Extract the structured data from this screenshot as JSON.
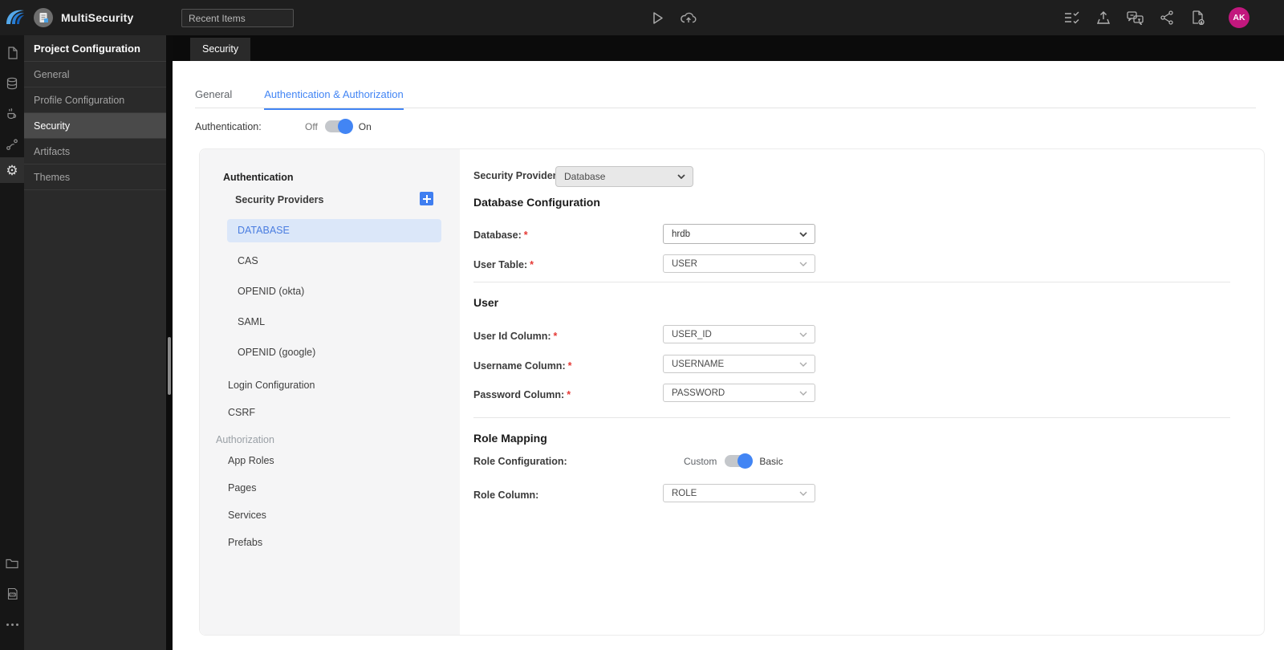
{
  "topbar": {
    "project_name": "MultiSecurity",
    "recent_items_placeholder": "Recent Items",
    "avatar_initials": "AK"
  },
  "nav": {
    "title": "Project Configuration",
    "items": [
      {
        "label": "General",
        "active": false
      },
      {
        "label": "Profile Configuration",
        "active": false
      },
      {
        "label": "Security",
        "active": true
      },
      {
        "label": "Artifacts",
        "active": false
      },
      {
        "label": "Themes",
        "active": false
      }
    ]
  },
  "tabbar": {
    "tabs": [
      {
        "label": "Security",
        "active": true
      }
    ]
  },
  "content": {
    "tabs": [
      {
        "label": "General",
        "active": false
      },
      {
        "label": "Authentication & Authorization",
        "active": true
      }
    ],
    "authentication_toggle": {
      "label": "Authentication:",
      "off_label": "Off",
      "on_label": "On",
      "state": "on"
    },
    "sidebar": {
      "authentication_title": "Authentication",
      "security_providers_title": "Security Providers",
      "providers": [
        {
          "label": "DATABASE",
          "selected": true
        },
        {
          "label": "CAS",
          "selected": false
        },
        {
          "label": "OPENID (okta)",
          "selected": false
        },
        {
          "label": "SAML",
          "selected": false
        },
        {
          "label": "OPENID (google)",
          "selected": false
        }
      ],
      "items": [
        {
          "label": "Login Configuration"
        },
        {
          "label": "CSRF"
        }
      ],
      "authorization_title": "Authorization",
      "authorization_items": [
        {
          "label": "App Roles"
        },
        {
          "label": "Pages"
        },
        {
          "label": "Services"
        },
        {
          "label": "Prefabs"
        }
      ]
    },
    "form": {
      "required_marker": "*",
      "security_provider": {
        "label": "Security Provider",
        "value": "Database"
      },
      "database_configuration": {
        "title": "Database Configuration",
        "fields": [
          {
            "label": "Database:",
            "required": true,
            "value": "hrdb"
          },
          {
            "label": "User Table:",
            "required": true,
            "value": "USER"
          }
        ]
      },
      "user_section": {
        "title": "User",
        "fields": [
          {
            "label": "User Id Column:",
            "required": true,
            "value": "USER_ID"
          },
          {
            "label": "Username Column:",
            "required": true,
            "value": "USERNAME"
          },
          {
            "label": "Password Column:",
            "required": true,
            "value": "PASSWORD"
          }
        ]
      },
      "role_mapping": {
        "title": "Role Mapping",
        "role_configuration": {
          "label": "Role Configuration:",
          "left_label": "Custom",
          "right_label": "Basic",
          "state": "basic"
        },
        "role_column": {
          "label": "Role Column:",
          "value": "ROLE"
        }
      }
    }
  },
  "colors": {
    "accent": "#4285f4",
    "avatar_bg": "#c2187e",
    "selected_item_bg": "#dbe7f9",
    "selected_item_text": "#4a7de0",
    "required": "#e53935"
  }
}
